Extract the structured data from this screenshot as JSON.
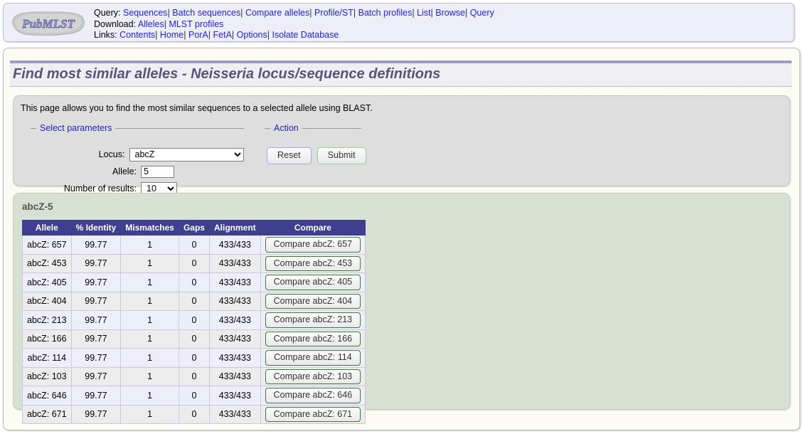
{
  "header": {
    "logo_text": "PubMLST",
    "nav_rows": [
      {
        "label": "Query:",
        "links": [
          "Sequences",
          "Batch sequences",
          "Compare alleles",
          "Profile/ST",
          "Batch profiles",
          "List",
          "Browse",
          "Query"
        ]
      },
      {
        "label": "Download:",
        "links": [
          "Alleles",
          "MLST profiles"
        ]
      },
      {
        "label": "Links:",
        "links": [
          "Contents",
          "Home",
          "PorA",
          "FetA",
          "Options",
          "Isolate Database"
        ]
      }
    ],
    "separator": "|"
  },
  "page": {
    "title": "Find most similar alleles - Neisseria locus/sequence definitions",
    "intro": "This page allows you to find the most similar sequences to a selected allele using BLAST."
  },
  "form": {
    "params_legend": "Select parameters",
    "action_legend": "Action",
    "locus_label": "Locus:",
    "locus_value": "abcZ",
    "locus_options": [
      "abcZ"
    ],
    "allele_label": "Allele:",
    "allele_value": "5",
    "numresults_label": "Number of results:",
    "numresults_value": "10",
    "numresults_options": [
      "10"
    ],
    "reset_label": "Reset",
    "submit_label": "Submit"
  },
  "results": {
    "heading": "abcZ-5",
    "columns": [
      "Allele",
      "% Identity",
      "Mismatches",
      "Gaps",
      "Alignment",
      "Compare"
    ],
    "rows": [
      {
        "allele": "abcZ: 657",
        "identity": "99.77",
        "mismatches": "1",
        "gaps": "0",
        "alignment": "433/433",
        "compare": "Compare abcZ: 657"
      },
      {
        "allele": "abcZ: 453",
        "identity": "99.77",
        "mismatches": "1",
        "gaps": "0",
        "alignment": "433/433",
        "compare": "Compare abcZ: 453"
      },
      {
        "allele": "abcZ: 405",
        "identity": "99.77",
        "mismatches": "1",
        "gaps": "0",
        "alignment": "433/433",
        "compare": "Compare abcZ: 405"
      },
      {
        "allele": "abcZ: 404",
        "identity": "99.77",
        "mismatches": "1",
        "gaps": "0",
        "alignment": "433/433",
        "compare": "Compare abcZ: 404"
      },
      {
        "allele": "abcZ: 213",
        "identity": "99.77",
        "mismatches": "1",
        "gaps": "0",
        "alignment": "433/433",
        "compare": "Compare abcZ: 213"
      },
      {
        "allele": "abcZ: 166",
        "identity": "99.77",
        "mismatches": "1",
        "gaps": "0",
        "alignment": "433/433",
        "compare": "Compare abcZ: 166"
      },
      {
        "allele": "abcZ: 114",
        "identity": "99.77",
        "mismatches": "1",
        "gaps": "0",
        "alignment": "433/433",
        "compare": "Compare abcZ: 114"
      },
      {
        "allele": "abcZ: 103",
        "identity": "99.77",
        "mismatches": "1",
        "gaps": "0",
        "alignment": "433/433",
        "compare": "Compare abcZ: 103"
      },
      {
        "allele": "abcZ: 646",
        "identity": "99.77",
        "mismatches": "1",
        "gaps": "0",
        "alignment": "433/433",
        "compare": "Compare abcZ: 646"
      },
      {
        "allele": "abcZ: 671",
        "identity": "99.77",
        "mismatches": "1",
        "gaps": "0",
        "alignment": "433/433",
        "compare": "Compare abcZ: 671"
      }
    ]
  },
  "colors": {
    "header_bg": "#eeeef8",
    "title_accent": "#9a9ccc",
    "title_text": "#55557a",
    "form_panel_bg": "#dedede",
    "results_panel_bg": "#d8e0d4",
    "table_header_bg": "#3f3f8f",
    "link": "#2222dd"
  }
}
